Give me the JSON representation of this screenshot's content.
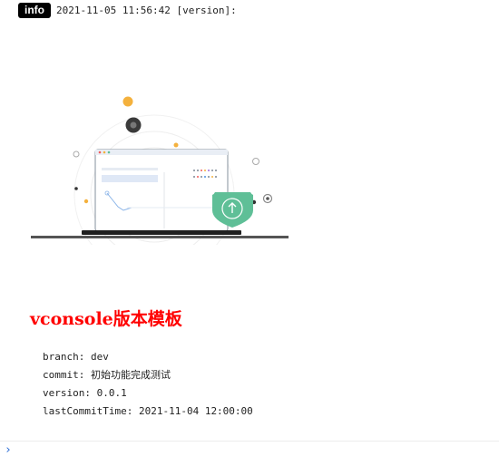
{
  "log": {
    "level": "info",
    "timestamp": "2021-11-05 11:56:42",
    "tag": "[version]:"
  },
  "illustration": {
    "accent_colors": {
      "orange": "#f4b13d",
      "green_shield": "#5fbf97",
      "dark": "#333333",
      "screen_bar": "#dfe8f6"
    }
  },
  "content": {
    "title": "vconsole版本模板",
    "title_color": "#ff0000",
    "fields": [
      {
        "key": "branch:",
        "value": "dev"
      },
      {
        "key": "commit:",
        "value": "初始功能完成测试"
      },
      {
        "key": "version:",
        "value": "0.0.1"
      },
      {
        "key": "lastCommitTime:",
        "value": "2021-11-04 12:00:00"
      }
    ]
  },
  "console": {
    "prompt_icon": "chevron-right-icon",
    "prompt_glyph": "›",
    "input_value": ""
  }
}
